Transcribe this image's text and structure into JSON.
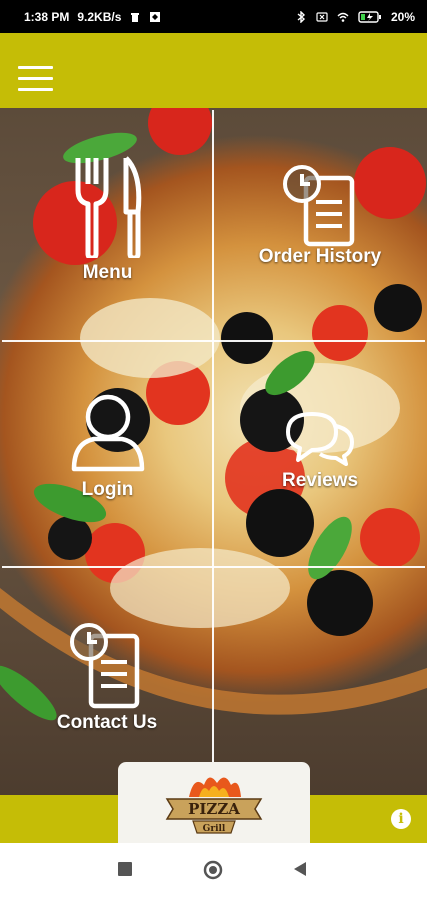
{
  "status_bar": {
    "time": "1:38 PM",
    "network_speed": "9.2KB/s",
    "battery_percent": "20%",
    "icons": [
      "trash-icon",
      "app-icon",
      "bluetooth-icon",
      "sim-icon",
      "wifi-icon",
      "battery-charging-icon"
    ]
  },
  "app_bar": {
    "menu_icon": "hamburger-icon",
    "color": "#c5bd06"
  },
  "tiles": [
    {
      "label": "Menu",
      "icon": "fork-knife-icon"
    },
    {
      "label": "Order History",
      "icon": "clock-document-icon"
    },
    {
      "label": "Login",
      "icon": "user-icon"
    },
    {
      "label": "Reviews",
      "icon": "chat-bubbles-icon"
    },
    {
      "label": "Contact Us",
      "icon": "clock-document-icon"
    }
  ],
  "logo": {
    "text_top": "PIZZA",
    "text_bottom": "Grill"
  },
  "bottom_bar": {
    "info_icon": "info-icon",
    "info_glyph": "i"
  },
  "nav_bar": {
    "buttons": [
      "recent-apps-button",
      "home-button",
      "back-button"
    ]
  }
}
